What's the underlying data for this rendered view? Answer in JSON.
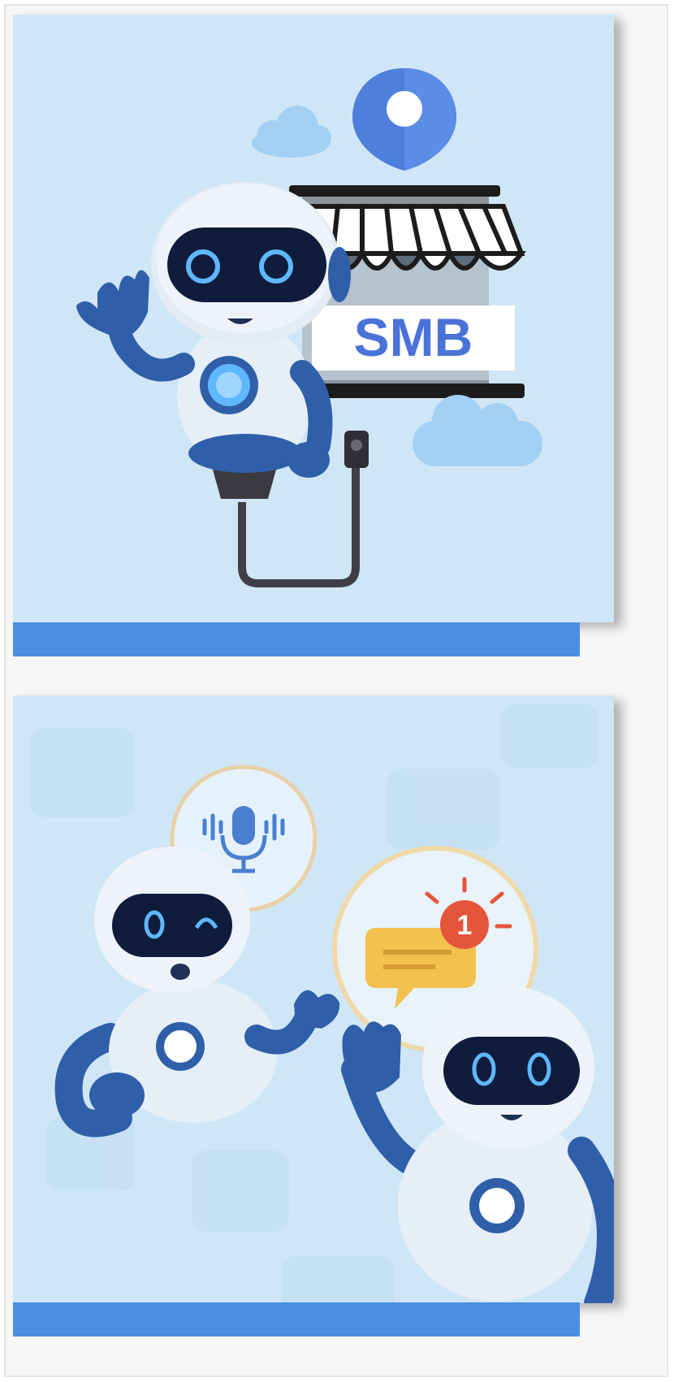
{
  "cards": [
    {
      "sign_text": "SMB"
    },
    {
      "notification_count": "1"
    }
  ],
  "colors": {
    "card_bg": "#cfe6f7",
    "bar": "#4a8fe2",
    "robot_blue": "#2f5fa8",
    "visor": "#0f1c3c",
    "glow": "#5fb8ff",
    "pin": "#4f7fdc",
    "sign_text": "#4a72d8"
  },
  "icons": [
    "robot-icon",
    "store-icon",
    "location-pin-icon",
    "cloud-icon",
    "plug-cable-icon",
    "microphone-icon",
    "chat-notification-icon"
  ]
}
